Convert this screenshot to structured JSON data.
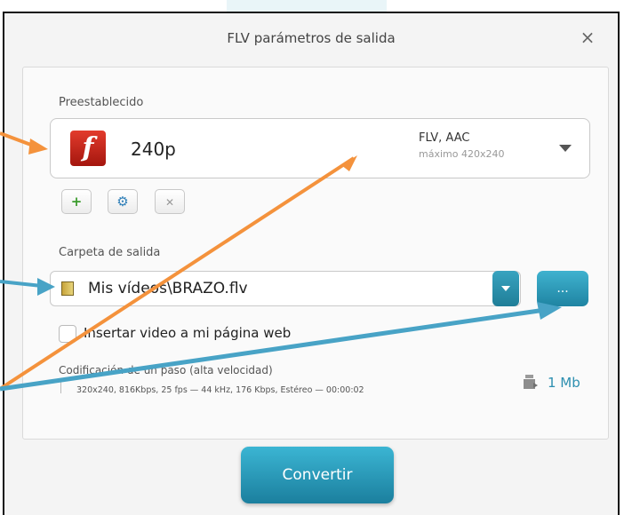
{
  "dialog": {
    "title": "FLV parámetros de salida",
    "close_symbol": "×"
  },
  "preset": {
    "section_label": "Preestablecido",
    "name": "240p",
    "format": "FLV, AAC",
    "resolution": "máximo 420x240",
    "icon": "flash-icon"
  },
  "preset_actions": [
    {
      "name": "add-preset-button",
      "symbol": "+",
      "color": "#3a9b2c"
    },
    {
      "name": "edit-preset-button",
      "symbol": "⚙",
      "color": "#2f7fb8"
    },
    {
      "name": "delete-preset-button",
      "symbol": "✕",
      "color": "#888888"
    }
  ],
  "output": {
    "section_label": "Carpeta de salida",
    "path": "Mis vídeos\\BRAZO.flv",
    "browse_label": "..."
  },
  "insert_web": {
    "label": "Insertar video a mi página web",
    "checked": false
  },
  "encoding": {
    "title": "Codificación de un paso (alta velocidad)",
    "detail": "320x240, 816Kbps, 25 fps — 44 kHz, 176 Kbps, Estéreo — 00:00:02"
  },
  "size": {
    "value": "1 Mb"
  },
  "convert_label": "Convertir",
  "colors": {
    "accent": "#2591b0",
    "annotation_orange": "#f4923c",
    "annotation_blue": "#48a3c6"
  }
}
